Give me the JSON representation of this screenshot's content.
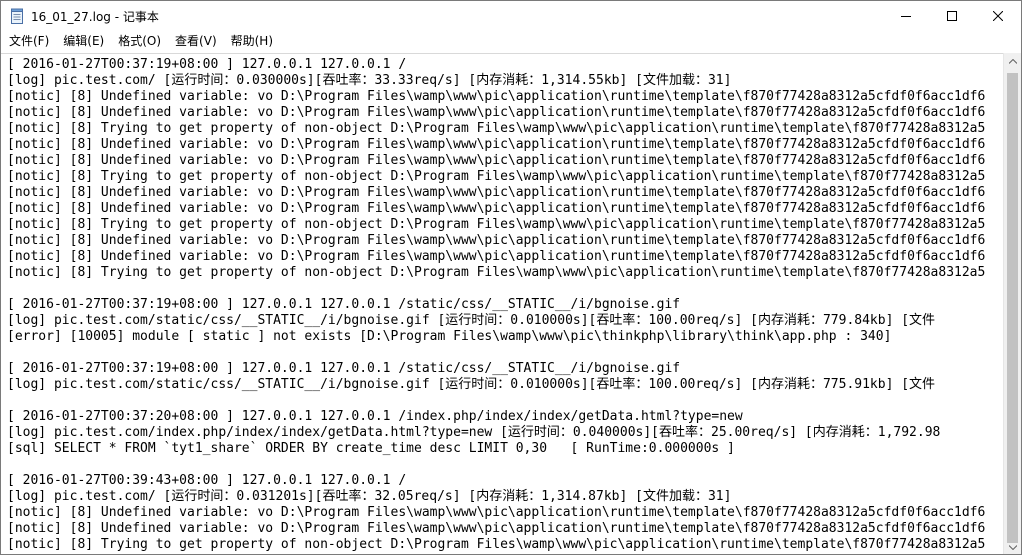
{
  "window": {
    "title": "16_01_27.log - 记事本"
  },
  "menu": [
    "文件(F)",
    "编辑(E)",
    "格式(O)",
    "查看(V)",
    "帮助(H)"
  ],
  "lines": [
    "[ 2016-01-27T00:37:19+08:00 ] 127.0.0.1 127.0.0.1 /",
    "[log] pic.test.com/ [运行时间：0.030000s][吞吐率：33.33req/s] [内存消耗：1,314.55kb] [文件加载：31]",
    "[notic] [8] Undefined variable: vo D:\\Program Files\\wamp\\www\\pic\\application\\runtime\\template\\f870f77428a8312a5cfdf0f6acc1df6",
    "[notic] [8] Undefined variable: vo D:\\Program Files\\wamp\\www\\pic\\application\\runtime\\template\\f870f77428a8312a5cfdf0f6acc1df6",
    "[notic] [8] Trying to get property of non-object D:\\Program Files\\wamp\\www\\pic\\application\\runtime\\template\\f870f77428a8312a5",
    "[notic] [8] Undefined variable: vo D:\\Program Files\\wamp\\www\\pic\\application\\runtime\\template\\f870f77428a8312a5cfdf0f6acc1df6",
    "[notic] [8] Undefined variable: vo D:\\Program Files\\wamp\\www\\pic\\application\\runtime\\template\\f870f77428a8312a5cfdf0f6acc1df6",
    "[notic] [8] Trying to get property of non-object D:\\Program Files\\wamp\\www\\pic\\application\\runtime\\template\\f870f77428a8312a5",
    "[notic] [8] Undefined variable: vo D:\\Program Files\\wamp\\www\\pic\\application\\runtime\\template\\f870f77428a8312a5cfdf0f6acc1df6",
    "[notic] [8] Undefined variable: vo D:\\Program Files\\wamp\\www\\pic\\application\\runtime\\template\\f870f77428a8312a5cfdf0f6acc1df6",
    "[notic] [8] Trying to get property of non-object D:\\Program Files\\wamp\\www\\pic\\application\\runtime\\template\\f870f77428a8312a5",
    "[notic] [8] Undefined variable: vo D:\\Program Files\\wamp\\www\\pic\\application\\runtime\\template\\f870f77428a8312a5cfdf0f6acc1df6",
    "[notic] [8] Undefined variable: vo D:\\Program Files\\wamp\\www\\pic\\application\\runtime\\template\\f870f77428a8312a5cfdf0f6acc1df6",
    "[notic] [8] Trying to get property of non-object D:\\Program Files\\wamp\\www\\pic\\application\\runtime\\template\\f870f77428a8312a5",
    "",
    "[ 2016-01-27T00:37:19+08:00 ] 127.0.0.1 127.0.0.1 /static/css/__STATIC__/i/bgnoise.gif",
    "[log] pic.test.com/static/css/__STATIC__/i/bgnoise.gif [运行时间：0.010000s][吞吐率：100.00req/s] [内存消耗：779.84kb] [文件",
    "[error] [10005] module [ static ] not exists [D:\\Program Files\\wamp\\www\\pic\\thinkphp\\library\\think\\app.php : 340]",
    "",
    "[ 2016-01-27T00:37:19+08:00 ] 127.0.0.1 127.0.0.1 /static/css/__STATIC__/i/bgnoise.gif",
    "[log] pic.test.com/static/css/__STATIC__/i/bgnoise.gif [运行时间：0.010000s][吞吐率：100.00req/s] [内存消耗：775.91kb] [文件",
    "",
    "[ 2016-01-27T00:37:20+08:00 ] 127.0.0.1 127.0.0.1 /index.php/index/index/getData.html?type=new",
    "[log] pic.test.com/index.php/index/index/getData.html?type=new [运行时间：0.040000s][吞吐率：25.00req/s] [内存消耗：1,792.98",
    "[sql] SELECT * FROM `tyt1_share` ORDER BY create_time desc LIMIT 0,30   [ RunTime:0.000000s ]",
    "",
    "[ 2016-01-27T00:39:43+08:00 ] 127.0.0.1 127.0.0.1 /",
    "[log] pic.test.com/ [运行时间：0.031201s][吞吐率：32.05req/s] [内存消耗：1,314.87kb] [文件加载：31]",
    "[notic] [8] Undefined variable: vo D:\\Program Files\\wamp\\www\\pic\\application\\runtime\\template\\f870f77428a8312a5cfdf0f6acc1df6",
    "[notic] [8] Undefined variable: vo D:\\Program Files\\wamp\\www\\pic\\application\\runtime\\template\\f870f77428a8312a5cfdf0f6acc1df6",
    "[notic] [8] Trying to get property of non-object D:\\Program Files\\wamp\\www\\pic\\application\\runtime\\template\\f870f77428a8312a5"
  ]
}
